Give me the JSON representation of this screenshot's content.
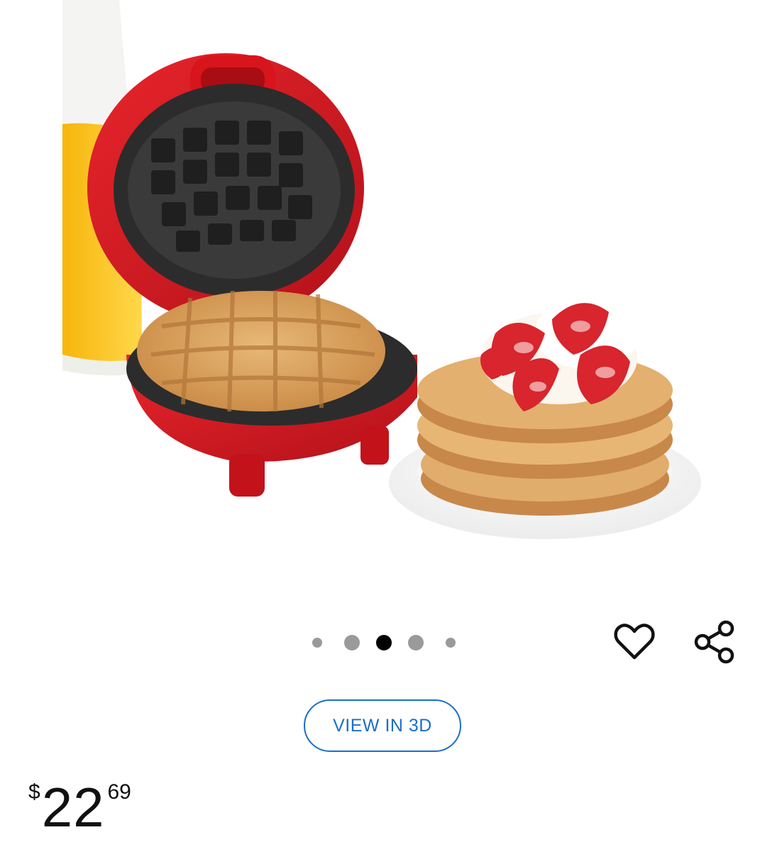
{
  "product": {
    "image_alt": "",
    "carousel": {
      "total": 5,
      "active_index": 2
    }
  },
  "actions": {
    "favorite_icon": "heart-outline-icon",
    "share_icon": "share-icon",
    "view3d_label": "VIEW IN 3D"
  },
  "price": {
    "currency": "$",
    "dollars": "22",
    "cents": "69"
  },
  "colors": {
    "accent": "#1b6fc8",
    "dot_active": "#000000",
    "dot_inactive": "#9a9a9a"
  }
}
